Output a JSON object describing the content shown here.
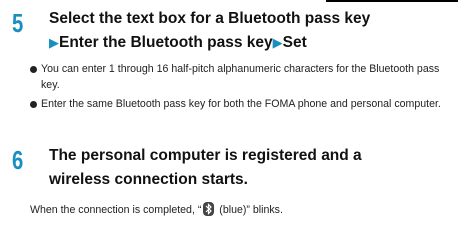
{
  "step5": {
    "number": "5",
    "line1": "Select the text box for a Bluetooth pass key",
    "part_a": "Enter the Bluetooth pass key",
    "part_b": "Set",
    "bullets": [
      "You can enter 1 through 16 half-pitch alphanumeric characters for the Bluetooth pass key.",
      "Enter the same Bluetooth pass key for both the FOMA phone and personal computer."
    ]
  },
  "step6": {
    "number": "6",
    "line1": "The personal computer is registered and a",
    "line2": "wireless connection starts.",
    "note_before": "When the connection is completed, “",
    "note_after": " (blue)” blinks."
  },
  "icons": {
    "arrow": "right-triangle-icon",
    "bluetooth": "bluetooth-icon"
  },
  "colors": {
    "accent": "#1a8fbf"
  }
}
